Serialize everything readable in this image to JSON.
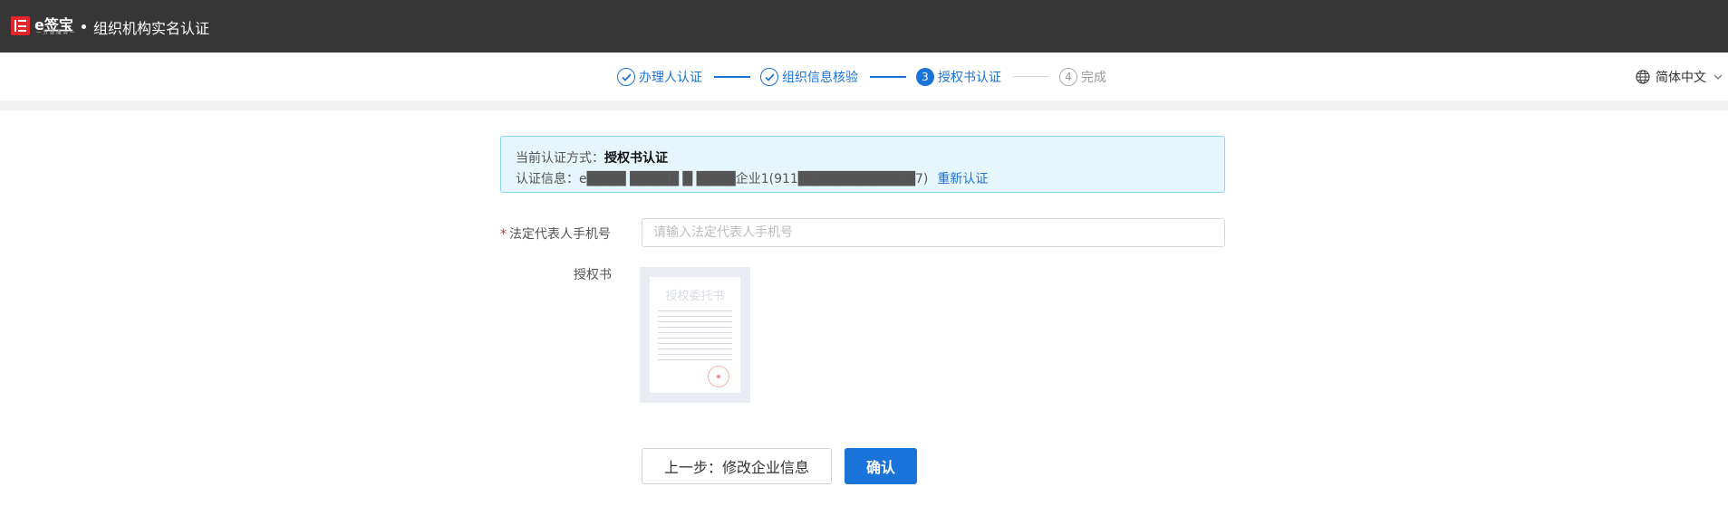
{
  "header": {
    "logo_text": "e签宝",
    "logo_sub": "一 分 签 服 务 一",
    "title": "组织机构实名认证"
  },
  "steps": [
    {
      "label": "办理人认证",
      "state": "done",
      "icon": "check-circle-icon"
    },
    {
      "label": "组织信息核验",
      "state": "done",
      "icon": "check-circle-icon"
    },
    {
      "label": "授权书认证",
      "state": "active",
      "number": "3"
    },
    {
      "label": "完成",
      "state": "todo",
      "number": "4"
    }
  ],
  "language": {
    "label": "简体中文",
    "icon": "globe-icon"
  },
  "info": {
    "method_prefix": "当前认证方式：",
    "method_value": "授权书认证",
    "info_prefix": "认证信息：",
    "info_value": "e████ █████ █ ████企业1(911████████████7)",
    "relink": "重新认证"
  },
  "form": {
    "phone_label": "法定代表人手机号",
    "phone_required_mark": "*",
    "phone_placeholder": "请输入法定代表人手机号",
    "auth_label": "授权书",
    "auth_thumb_title": "授权委托书"
  },
  "buttons": {
    "prev": "上一步：修改企业信息",
    "confirm": "确认"
  },
  "colors": {
    "primary": "#1a73d9",
    "topbar": "#363636",
    "brand_red": "#e4262c",
    "info_bg": "#e6f6fd"
  }
}
